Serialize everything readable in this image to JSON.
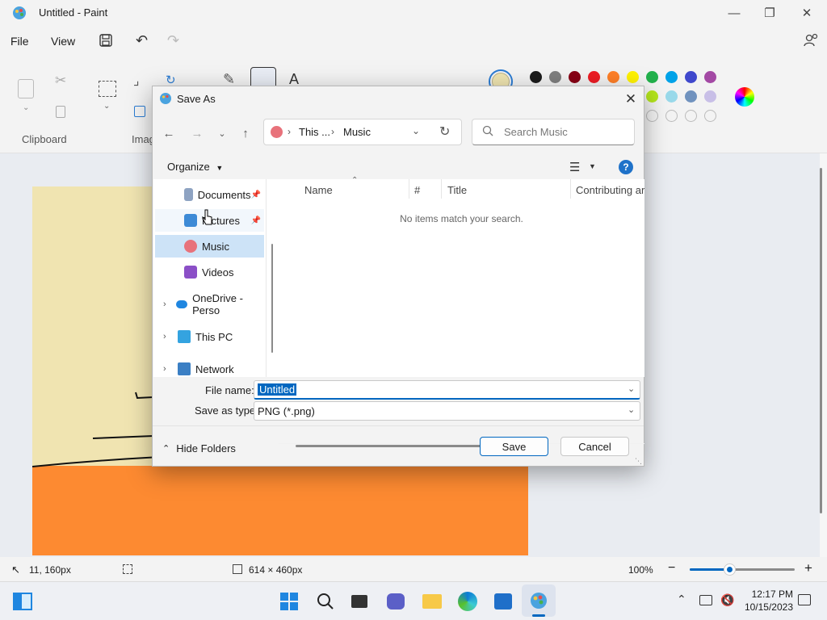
{
  "app": {
    "title": "Untitled - Paint",
    "menu": [
      "File",
      "View"
    ],
    "ribbon_groups": {
      "clipboard": "Clipboard",
      "image": "Imag"
    },
    "palette_row1": [
      "#1b1b1b",
      "#7f7f7f",
      "#880015",
      "#ed1c24",
      "#ff7f27",
      "#fff200",
      "#22b14c",
      "#00a2e8",
      "#3f48cc",
      "#a349a4"
    ],
    "palette_row2": [
      "#b5e61d",
      "#99d9ea",
      "#7092be",
      "#c8bfe7"
    ],
    "active_color": "#efe4b0",
    "canvas_colors": {
      "sky": "#f0e4b1",
      "ground": "#fd8a31"
    }
  },
  "statusbar": {
    "cursor_pos": "11, 160px",
    "canvas_size": "614 × 460px",
    "zoom": "100%"
  },
  "taskbar": {
    "time": "12:17 PM",
    "date": "10/15/2023"
  },
  "dialog": {
    "title": "Save As",
    "address": {
      "seg1": "This ...",
      "seg2": "Music"
    },
    "search_placeholder": "Search Music",
    "organize_label": "Organize",
    "nav_items": [
      {
        "label": "Documents",
        "pinned": true
      },
      {
        "label": "Pictures",
        "pinned": true
      },
      {
        "label": "Music",
        "selected": true
      },
      {
        "label": "Videos"
      },
      {
        "label": "OneDrive - Perso",
        "expandable": true
      },
      {
        "label": "This PC",
        "expandable": true
      },
      {
        "label": "Network",
        "expandable": true
      }
    ],
    "columns": [
      "Name",
      "#",
      "Title",
      "Contributing art"
    ],
    "empty_message": "No items match your search.",
    "file_name_label": "File name:",
    "file_name_value": "Untitled",
    "save_type_label": "Save as type:",
    "save_type_value": "PNG (*.png)",
    "hide_folders_label": "Hide Folders",
    "save_label": "Save",
    "cancel_label": "Cancel"
  }
}
